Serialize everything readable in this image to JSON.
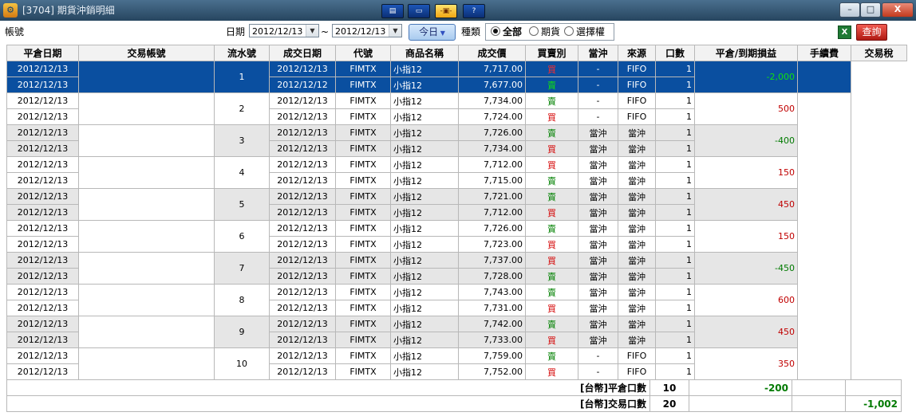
{
  "window": {
    "title": "[3704] 期貨沖銷明細",
    "toolbar_buttons": [
      {
        "icon": "layout-icon",
        "label": "▤"
      },
      {
        "icon": "window-icon",
        "label": "▭"
      },
      {
        "icon": "pin-icon",
        "label": "-▣-"
      },
      {
        "icon": "help-icon",
        "label": "?"
      }
    ],
    "controls": {
      "minimize": "–",
      "maximize": "□",
      "close": "X"
    }
  },
  "filters": {
    "account_label": "帳號",
    "date_label": "日期",
    "date_from": "2012/12/13",
    "tilde": "~",
    "date_to": "2012/12/13",
    "today_button": "今日",
    "type_label": "種類",
    "types": [
      {
        "label": "全部",
        "selected": true
      },
      {
        "label": "期貨",
        "selected": false
      },
      {
        "label": "選擇權",
        "selected": false
      }
    ],
    "excel_label": "X",
    "query_button": "查詢"
  },
  "table": {
    "headers": [
      "平倉日期",
      "交易帳號",
      "流水號",
      "成交日期",
      "代號",
      "商品名稱",
      "成交價",
      "買賣別",
      "當沖",
      "來源",
      "口數",
      "平倉/到期損益",
      "手續費",
      "交易稅"
    ],
    "groups": [
      {
        "seq": "1",
        "pnl": "-2,000",
        "rows": [
          {
            "close_date": "2012/12/13",
            "trade_date": "2012/12/13",
            "code": "FIMTX",
            "name": "小指12",
            "price": "7,717.00",
            "side": "買",
            "daytrade": "-",
            "source": "FIFO",
            "qty": "1"
          },
          {
            "close_date": "2012/12/13",
            "trade_date": "2012/12/12",
            "code": "FIMTX",
            "name": "小指12",
            "price": "7,677.00",
            "side": "賣",
            "daytrade": "-",
            "source": "FIFO",
            "qty": "1"
          }
        ]
      },
      {
        "seq": "2",
        "pnl": "500",
        "rows": [
          {
            "close_date": "2012/12/13",
            "trade_date": "2012/12/13",
            "code": "FIMTX",
            "name": "小指12",
            "price": "7,734.00",
            "side": "賣",
            "daytrade": "-",
            "source": "FIFO",
            "qty": "1"
          },
          {
            "close_date": "2012/12/13",
            "trade_date": "2012/12/13",
            "code": "FIMTX",
            "name": "小指12",
            "price": "7,724.00",
            "side": "買",
            "daytrade": "-",
            "source": "FIFO",
            "qty": "1"
          }
        ]
      },
      {
        "seq": "3",
        "pnl": "-400",
        "rows": [
          {
            "close_date": "2012/12/13",
            "trade_date": "2012/12/13",
            "code": "FIMTX",
            "name": "小指12",
            "price": "7,726.00",
            "side": "賣",
            "daytrade": "當沖",
            "source": "當沖",
            "qty": "1"
          },
          {
            "close_date": "2012/12/13",
            "trade_date": "2012/12/13",
            "code": "FIMTX",
            "name": "小指12",
            "price": "7,734.00",
            "side": "買",
            "daytrade": "當沖",
            "source": "當沖",
            "qty": "1"
          }
        ]
      },
      {
        "seq": "4",
        "pnl": "150",
        "rows": [
          {
            "close_date": "2012/12/13",
            "trade_date": "2012/12/13",
            "code": "FIMTX",
            "name": "小指12",
            "price": "7,712.00",
            "side": "買",
            "daytrade": "當沖",
            "source": "當沖",
            "qty": "1"
          },
          {
            "close_date": "2012/12/13",
            "trade_date": "2012/12/13",
            "code": "FIMTX",
            "name": "小指12",
            "price": "7,715.00",
            "side": "賣",
            "daytrade": "當沖",
            "source": "當沖",
            "qty": "1"
          }
        ]
      },
      {
        "seq": "5",
        "pnl": "450",
        "rows": [
          {
            "close_date": "2012/12/13",
            "trade_date": "2012/12/13",
            "code": "FIMTX",
            "name": "小指12",
            "price": "7,721.00",
            "side": "賣",
            "daytrade": "當沖",
            "source": "當沖",
            "qty": "1"
          },
          {
            "close_date": "2012/12/13",
            "trade_date": "2012/12/13",
            "code": "FIMTX",
            "name": "小指12",
            "price": "7,712.00",
            "side": "買",
            "daytrade": "當沖",
            "source": "當沖",
            "qty": "1"
          }
        ]
      },
      {
        "seq": "6",
        "pnl": "150",
        "rows": [
          {
            "close_date": "2012/12/13",
            "trade_date": "2012/12/13",
            "code": "FIMTX",
            "name": "小指12",
            "price": "7,726.00",
            "side": "賣",
            "daytrade": "當沖",
            "source": "當沖",
            "qty": "1"
          },
          {
            "close_date": "2012/12/13",
            "trade_date": "2012/12/13",
            "code": "FIMTX",
            "name": "小指12",
            "price": "7,723.00",
            "side": "買",
            "daytrade": "當沖",
            "source": "當沖",
            "qty": "1"
          }
        ]
      },
      {
        "seq": "7",
        "pnl": "-450",
        "rows": [
          {
            "close_date": "2012/12/13",
            "trade_date": "2012/12/13",
            "code": "FIMTX",
            "name": "小指12",
            "price": "7,737.00",
            "side": "買",
            "daytrade": "當沖",
            "source": "當沖",
            "qty": "1"
          },
          {
            "close_date": "2012/12/13",
            "trade_date": "2012/12/13",
            "code": "FIMTX",
            "name": "小指12",
            "price": "7,728.00",
            "side": "賣",
            "daytrade": "當沖",
            "source": "當沖",
            "qty": "1"
          }
        ]
      },
      {
        "seq": "8",
        "pnl": "600",
        "rows": [
          {
            "close_date": "2012/12/13",
            "trade_date": "2012/12/13",
            "code": "FIMTX",
            "name": "小指12",
            "price": "7,743.00",
            "side": "賣",
            "daytrade": "當沖",
            "source": "當沖",
            "qty": "1"
          },
          {
            "close_date": "2012/12/13",
            "trade_date": "2012/12/13",
            "code": "FIMTX",
            "name": "小指12",
            "price": "7,731.00",
            "side": "買",
            "daytrade": "當沖",
            "source": "當沖",
            "qty": "1"
          }
        ]
      },
      {
        "seq": "9",
        "pnl": "450",
        "rows": [
          {
            "close_date": "2012/12/13",
            "trade_date": "2012/12/13",
            "code": "FIMTX",
            "name": "小指12",
            "price": "7,742.00",
            "side": "賣",
            "daytrade": "當沖",
            "source": "當沖",
            "qty": "1"
          },
          {
            "close_date": "2012/12/13",
            "trade_date": "2012/12/13",
            "code": "FIMTX",
            "name": "小指12",
            "price": "7,733.00",
            "side": "買",
            "daytrade": "當沖",
            "source": "當沖",
            "qty": "1"
          }
        ]
      },
      {
        "seq": "10",
        "pnl": "350",
        "rows": [
          {
            "close_date": "2012/12/13",
            "trade_date": "2012/12/13",
            "code": "FIMTX",
            "name": "小指12",
            "price": "7,759.00",
            "side": "賣",
            "daytrade": "-",
            "source": "FIFO",
            "qty": "1"
          },
          {
            "close_date": "2012/12/13",
            "trade_date": "2012/12/13",
            "code": "FIMTX",
            "name": "小指12",
            "price": "7,752.00",
            "side": "買",
            "daytrade": "-",
            "source": "FIFO",
            "qty": "1"
          }
        ]
      }
    ],
    "summary": [
      {
        "label": "[台幣]平倉口數",
        "qty": "10",
        "value": "-200",
        "col": "pnl"
      },
      {
        "label": "[台幣]交易口數",
        "qty": "20",
        "value": "-1,002",
        "col": "tax"
      }
    ]
  },
  "colors": {
    "selected_row": "#0a4fa0",
    "shaded_row": "#e6e6e6",
    "buy": "#d40000",
    "sell": "#008000",
    "header_bg": "#f2f2f2"
  }
}
